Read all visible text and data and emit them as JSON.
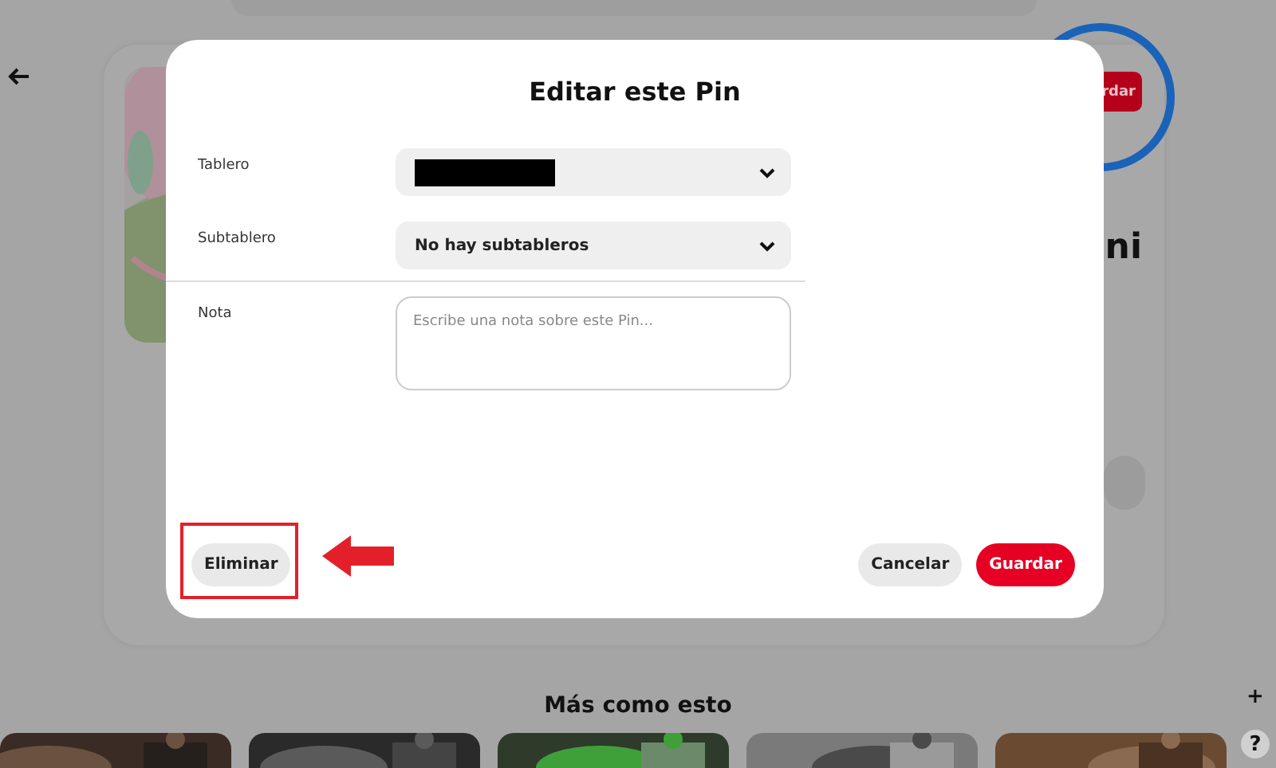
{
  "background_page": {
    "save_button": {
      "label": "rdar",
      "circled": true
    },
    "heading": "ni",
    "section_title": "Más como esto",
    "thumbnails": [
      {
        "kind": "picture"
      },
      {
        "kind": "picture"
      },
      {
        "kind": "picture"
      },
      {
        "kind": "picture"
      },
      {
        "kind": "picture"
      }
    ],
    "floating_buttons": [
      "+",
      "?"
    ]
  },
  "modal": {
    "title": "Editar este Pin",
    "fields": [
      {
        "label": "Tablero",
        "kind": "select",
        "redacted": true
      },
      {
        "label": "Subtablero",
        "kind": "select",
        "value": "No hay subtableros"
      },
      {
        "label": "Nota",
        "kind": "textarea",
        "placeholder": "Escribe una nota sobre este Pin..."
      }
    ],
    "buttons": [
      {
        "label": "Eliminar",
        "kind": "secondary",
        "highlighted": true
      },
      {
        "label": "Cancelar",
        "kind": "secondary",
        "highlighted": false
      },
      {
        "label": "Guardar",
        "kind": "primary",
        "highlighted": false
      }
    ]
  }
}
